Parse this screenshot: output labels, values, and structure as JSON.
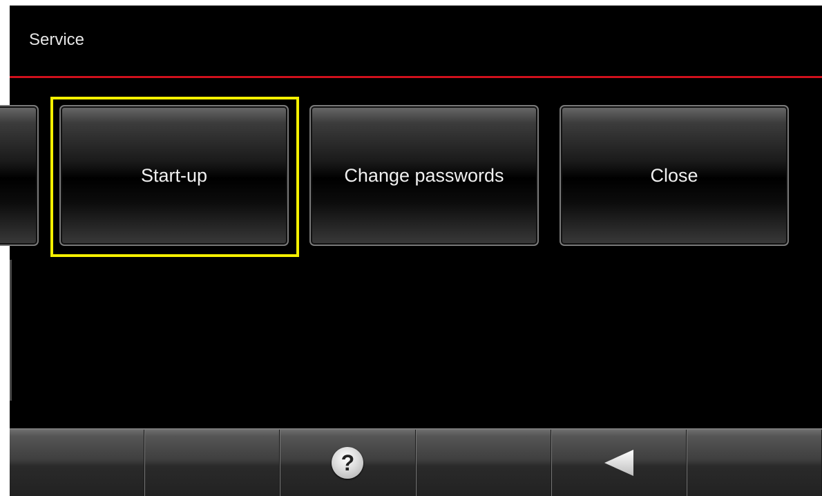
{
  "header": {
    "title": "Service"
  },
  "buttons": {
    "startup": "Start-up",
    "change_passwords": "Change passwords",
    "close": "Close"
  },
  "toolbar": {
    "help_glyph": "?",
    "icons": [
      "help-icon",
      "back-arrow-icon"
    ]
  },
  "colors": {
    "accent_line": "#d0101c",
    "focus_ring": "#f5f000"
  }
}
